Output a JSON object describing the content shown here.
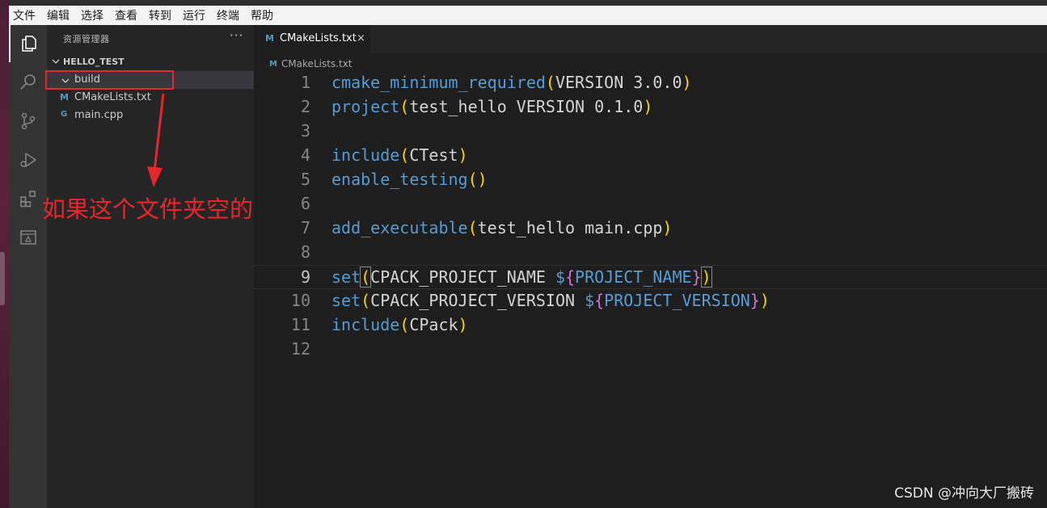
{
  "menubar": {
    "items": [
      "文件",
      "编辑",
      "选择",
      "查看",
      "转到",
      "运行",
      "终端",
      "帮助"
    ]
  },
  "activity_bar": {
    "icons": [
      "explorer-icon",
      "search-icon",
      "source-control-icon",
      "run-debug-icon",
      "extensions-icon",
      "remote-explorer-icon"
    ]
  },
  "sidebar": {
    "title": "资源管理器",
    "more": "···",
    "section": "HELLO_TEST",
    "items": [
      {
        "label": "build",
        "icon": "chevron-down-icon",
        "selected": true
      },
      {
        "label": "CMakeLists.txt",
        "icon": "cmake-file-icon",
        "icon_text": "M"
      },
      {
        "label": "main.cpp",
        "icon": "cpp-file-icon",
        "icon_text": "G"
      }
    ]
  },
  "annotation": {
    "text": "如果这个文件夹空的",
    "color": "#e6262a"
  },
  "tabs": [
    {
      "label": "CMakeLists.txt",
      "icon_text": "M",
      "close": "×",
      "active": true
    }
  ],
  "breadcrumb": {
    "icon_text": "M",
    "label": "CMakeLists.txt"
  },
  "editor": {
    "current_line": 9,
    "lines": [
      {
        "n": "1",
        "tokens": [
          [
            "fn",
            "cmake_minimum_required"
          ],
          [
            "p",
            "("
          ],
          [
            "txt",
            "VERSION 3.0.0"
          ],
          [
            "p",
            ")"
          ]
        ]
      },
      {
        "n": "2",
        "tokens": [
          [
            "fn",
            "project"
          ],
          [
            "p",
            "("
          ],
          [
            "txt",
            "test_hello VERSION 0.1.0"
          ],
          [
            "p",
            ")"
          ]
        ]
      },
      {
        "n": "3",
        "tokens": []
      },
      {
        "n": "4",
        "tokens": [
          [
            "fn",
            "include"
          ],
          [
            "p",
            "("
          ],
          [
            "txt",
            "CTest"
          ],
          [
            "p",
            ")"
          ]
        ]
      },
      {
        "n": "5",
        "tokens": [
          [
            "fn",
            "enable_testing"
          ],
          [
            "p",
            "()"
          ]
        ]
      },
      {
        "n": "6",
        "tokens": []
      },
      {
        "n": "7",
        "tokens": [
          [
            "fn",
            "add_executable"
          ],
          [
            "p",
            "("
          ],
          [
            "txt",
            "test_hello main.cpp"
          ],
          [
            "p",
            ")"
          ]
        ]
      },
      {
        "n": "8",
        "tokens": []
      },
      {
        "n": "9",
        "tokens": [
          [
            "fn",
            "set"
          ],
          [
            "pbox",
            "("
          ],
          [
            "txt",
            "CPACK_PROJECT_NAME "
          ],
          [
            "var",
            "$"
          ],
          [
            "v",
            "{"
          ],
          [
            "var",
            "PROJECT_NAME"
          ],
          [
            "v",
            "}"
          ],
          [
            "pbox",
            ")"
          ]
        ]
      },
      {
        "n": "10",
        "tokens": [
          [
            "fn",
            "set"
          ],
          [
            "p",
            "("
          ],
          [
            "txt",
            "CPACK_PROJECT_VERSION "
          ],
          [
            "var",
            "$"
          ],
          [
            "v",
            "{"
          ],
          [
            "var",
            "PROJECT_VERSION"
          ],
          [
            "v",
            "}"
          ],
          [
            "p",
            ")"
          ]
        ]
      },
      {
        "n": "11",
        "tokens": [
          [
            "fn",
            "include"
          ],
          [
            "p",
            "("
          ],
          [
            "txt",
            "CPack"
          ],
          [
            "p",
            ")"
          ]
        ]
      },
      {
        "n": "12",
        "tokens": []
      }
    ]
  },
  "watermark": "CSDN @冲向大厂搬砖",
  "colors": {
    "keyword": "#569cd6",
    "bracket": "#ffd700",
    "brace": "#da70d6",
    "text": "#d4d4d4",
    "cmake_icon": "#519aba"
  }
}
